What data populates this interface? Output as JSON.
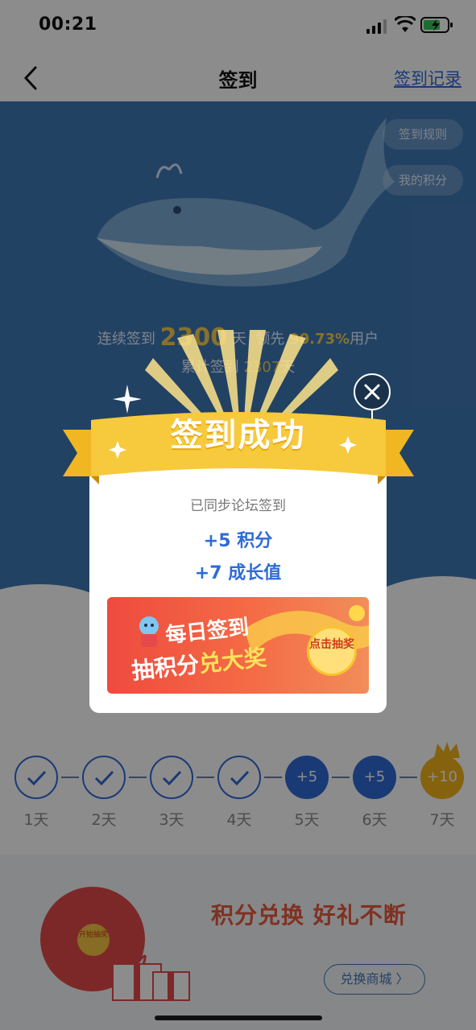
{
  "status_bar": {
    "time": "00:21"
  },
  "nav": {
    "title": "签到",
    "record_link": "签到记录"
  },
  "hero": {
    "rules_button": "签到规则",
    "points_button": "我的积分",
    "streak_prefix": "连续签到",
    "streak_days": "2300",
    "streak_unit": "天",
    "lead_prefix": "领先",
    "lead_pct": "90.73%",
    "lead_suffix": "用户",
    "total_prefix": "累计签到",
    "total_days": "2307",
    "total_suffix": "天"
  },
  "popup": {
    "title": "签到成功",
    "sync_text": "已同步论坛签到",
    "points_reward": "+5 积分",
    "growth_reward": "+7 成长值",
    "banner": {
      "line1": "每日签到",
      "line2_prefix": "抽积分",
      "line2_highlight": "兑大奖",
      "button": "点击抽奖"
    }
  },
  "days": [
    {
      "label": "1天",
      "state": "done"
    },
    {
      "label": "2天",
      "state": "done"
    },
    {
      "label": "3天",
      "state": "done"
    },
    {
      "label": "4天",
      "state": "done"
    },
    {
      "label": "5天",
      "state": "bonus",
      "value": "+5"
    },
    {
      "label": "6天",
      "state": "bonus",
      "value": "+5"
    },
    {
      "label": "7天",
      "state": "gold",
      "value": "+10"
    }
  ],
  "promo": {
    "title": "积分兑换 好礼不断",
    "shop_button": "兑换商城 〉",
    "wheel_center": "开始抽奖"
  },
  "colors": {
    "accent": "#2f6bd6",
    "hero_bg": "#3f78b7",
    "gold": "#f2b21a",
    "promo_red": "#e85a3c",
    "ribbon": "#f7c93c"
  }
}
